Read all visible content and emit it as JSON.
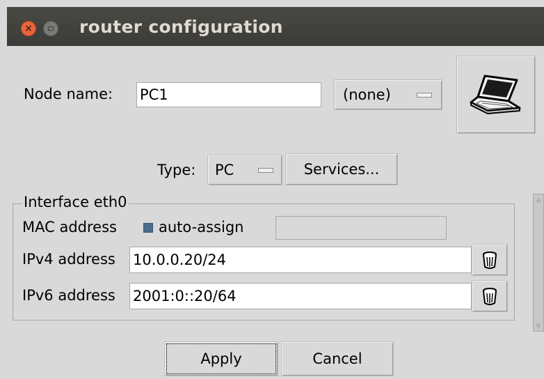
{
  "window": {
    "title": "router configuration"
  },
  "node": {
    "name_label": "Node name:",
    "name_value": "PC1",
    "model_value": "(none)",
    "type_label": "Type:",
    "type_value": "PC",
    "services_label": "Services..."
  },
  "interface": {
    "group_title": "Interface eth0",
    "mac_label": "MAC address",
    "auto_assign_label": "auto-assign",
    "auto_assign_checked": true,
    "mac_value": "",
    "ipv4_label": "IPv4 address",
    "ipv4_value": "10.0.0.20/24",
    "ipv6_label": "IPv6 address",
    "ipv6_value": "2001:0::20/64"
  },
  "buttons": {
    "apply_label": "Apply",
    "cancel_label": "Cancel"
  },
  "icons": {
    "close": "close-icon",
    "minimize": "minimize-icon",
    "node": "laptop-icon",
    "delete": "trash-icon"
  },
  "colors": {
    "titlebar": "#3c3b37",
    "close_button": "#e9643a",
    "checkbox": "#4a6d8c",
    "background": "#d9d9d9"
  }
}
